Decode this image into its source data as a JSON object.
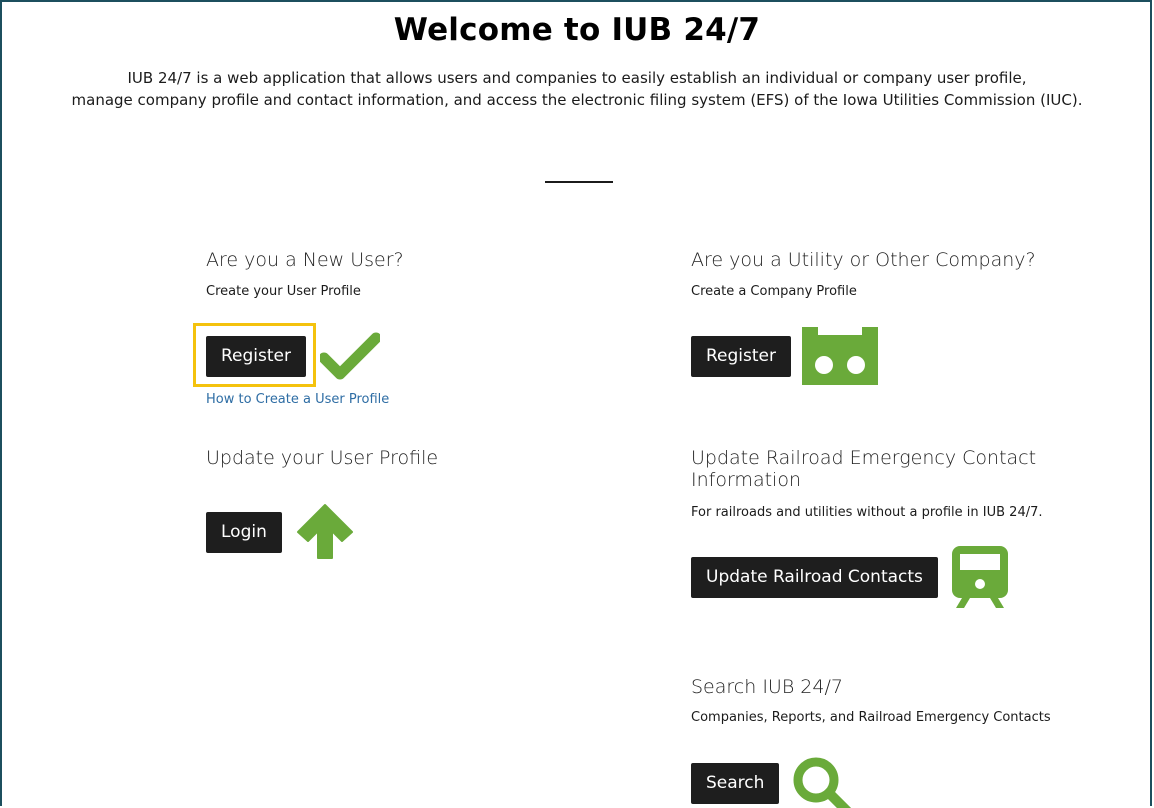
{
  "header": {
    "title": "Welcome to IUB 24/7",
    "intro_line1": "IUB 24/7 is a web application that allows users and companies to easily establish an individual or company user profile,",
    "intro_line2": "manage company profile and contact information, and access the electronic filing system (EFS) of the Iowa Utilities Commission (IUC)."
  },
  "new_user": {
    "heading": "Are you a New User?",
    "subtext": "Create your User Profile",
    "register_label": "Register",
    "help_link": "How to Create a User Profile",
    "icon": "checkmark-icon"
  },
  "update_user": {
    "heading": "Update your User Profile",
    "login_label": "Login",
    "icon": "up-arrow-icon"
  },
  "company": {
    "heading": "Are you a Utility or Other Company?",
    "subtext": "Create a Company Profile",
    "register_label": "Register",
    "icon": "company-icon"
  },
  "railroad": {
    "heading_line1": "Update Railroad Emergency Contact",
    "heading_line2": "Information",
    "subtext": "For railroads and utilities without a profile in IUB 24/7.",
    "button_label": "Update Railroad Contacts",
    "icon": "train-icon"
  },
  "search": {
    "heading": "Search IUB 24/7",
    "subtext": "Companies, Reports, and Railroad Emergency Contacts",
    "button_label": "Search",
    "icon": "search-icon"
  },
  "colors": {
    "accent_green": "#6aaa3a",
    "button_dark": "#1e1e1e",
    "highlight_yellow": "#f4c20d",
    "link_blue": "#2e6da4",
    "frame_border": "#1c4f5e"
  }
}
